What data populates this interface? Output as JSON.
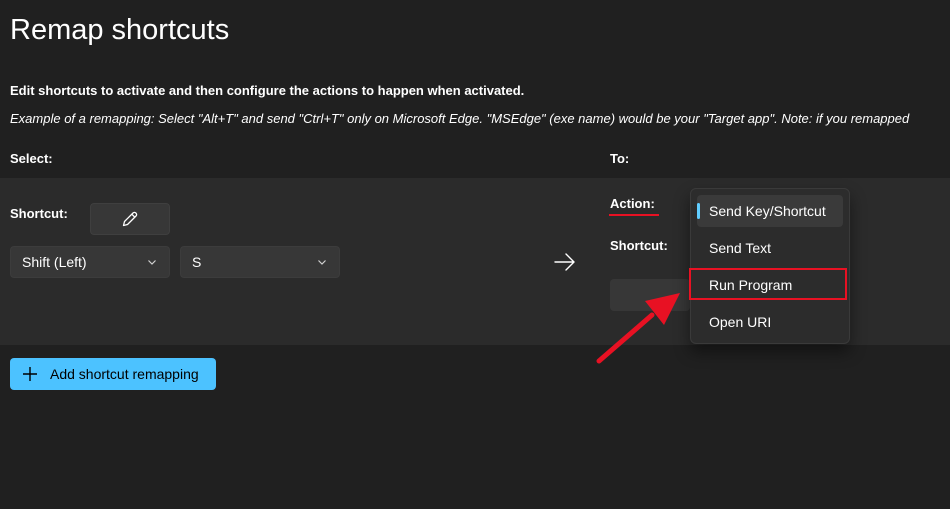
{
  "page": {
    "title": "Remap shortcuts",
    "description": "Edit shortcuts to activate and then configure the actions to happen when activated.",
    "example": "Example of a remapping: Select \"Alt+T\" and send \"Ctrl+T\" only on Microsoft Edge. \"MSEdge\" (exe name) would be your \"Target app\". Note: if you remapped"
  },
  "columns": {
    "select_label": "Select:",
    "to_label": "To:"
  },
  "select": {
    "shortcut_label": "Shortcut:",
    "modifier_value": "Shift (Left)",
    "key_value": "S"
  },
  "to": {
    "action_label": "Action:",
    "shortcut_label": "Shortcut:"
  },
  "action_dropdown": {
    "items": [
      {
        "label": "Send Key/Shortcut",
        "selected": true
      },
      {
        "label": "Send Text",
        "selected": false
      },
      {
        "label": "Run Program",
        "selected": false
      },
      {
        "label": "Open URI",
        "selected": false
      }
    ]
  },
  "footer": {
    "add_button_label": "Add shortcut remapping"
  },
  "colors": {
    "accent": "#4cc2ff",
    "selection_indicator": "#60cdff",
    "annotation_red": "#e81123",
    "background": "#202020",
    "panel": "#2b2b2b"
  },
  "icons": {
    "edit": "pencil-icon",
    "chevron": "chevron-down-icon",
    "arrow": "arrow-right-icon",
    "add": "plus-icon"
  }
}
